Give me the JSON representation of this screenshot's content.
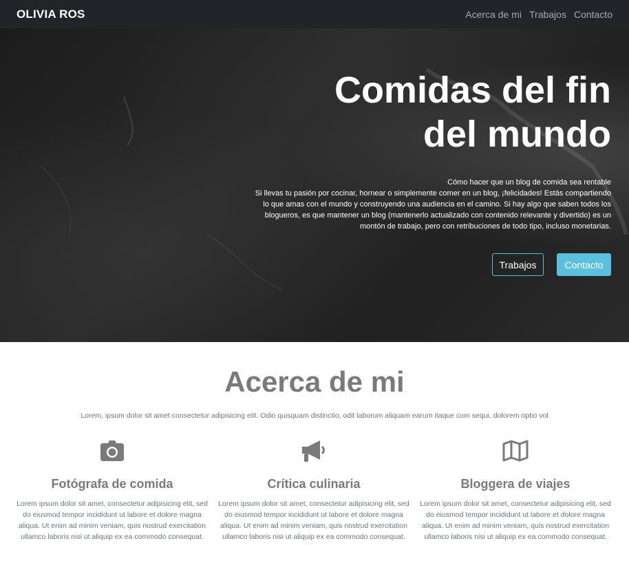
{
  "nav": {
    "brand": "OLIVIA ROS",
    "links": [
      "Acerca de mi",
      "Trabajos",
      "Contacto"
    ]
  },
  "hero": {
    "title_line1": "Comidas del fin",
    "title_line2": "del mundo",
    "subtitle": "Cómo hacer que un blog de comida sea rentable",
    "text": "Si llevas tu pasión por cocinar, hornear o simplemente comer en un blog, ¡felicidades! Estás compartiendo lo que amas con el mundo y construyendo una audiencia en el camino. Si hay algo que saben todos los blogueros, es que mantener un blog (mantenerlo actualizado con contenido relevante y divertido) es un montón de trabajo, pero con retribuciones de todo tipo, incluso monetarias.",
    "btn_works": "Trabajos",
    "btn_contact": "Contacto"
  },
  "about": {
    "title": "Acerca de mi",
    "lead": "Lorem, ipsum dolor sit amet consectetur adipisicing elit. Odio quisquam distinctio, odit laborum aliquam earum itaque cum sequi, dolorem optio vol",
    "columns": [
      {
        "icon": "camera-icon",
        "title": "Fotógrafa de comida",
        "text": "Lorem ipsum dolor sit amet, consectetur adipisicing elit, sed do eiusmod tempor incididunt ut labore et dolore magna aliqua. Ut enim ad minim veniam, quis nostrud exercitation ullamco laboris nisi ut aliquip ex ea commodo consequat."
      },
      {
        "icon": "megaphone-icon",
        "title": "Crítica culinaria",
        "text": "Lorem ipsum dolor sit amet, consectetur adipisicing elit, sed do eiusmod tempor incididunt ut labore et dolore magna aliqua. Ut enim ad minim veniam, quis nostrud exercitation ullamco laboris nisi ut aliquip ex ea commodo consequat."
      },
      {
        "icon": "map-icon",
        "title": "Bloggera de viajes",
        "text": "Lorem ipsum dolor sit amet, consectetur adipisicing elit, sed do eiusmod tempor incididunt ut labore et dolore magna aliqua. Ut enim ad minim veniam, quis nostrud exercitation ullamco laboris nisi ut aliquip ex ea commodo consequat."
      }
    ]
  },
  "colors": {
    "navbar_bg": "#212529",
    "accent": "#5bc0de",
    "heading_gray": "#7a7a7a"
  }
}
